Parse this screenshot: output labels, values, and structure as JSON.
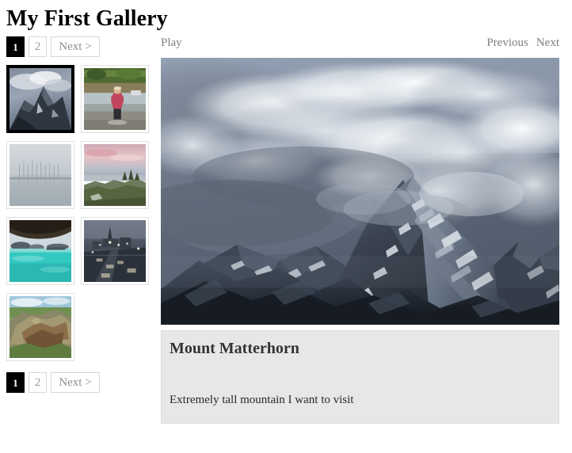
{
  "page": {
    "title": "My First Gallery"
  },
  "pagination": {
    "pages": [
      {
        "label": "1",
        "active": true
      },
      {
        "label": "2",
        "active": false
      }
    ],
    "next_label": "Next >"
  },
  "stage_controls": {
    "play_label": "Play",
    "previous_label": "Previous",
    "next_label": "Next"
  },
  "thumbnails": [
    {
      "name": "thumb-mount-matterhorn",
      "alt": "Mount Matterhorn peak with clouds",
      "selected": true
    },
    {
      "name": "thumb-person-at-river",
      "alt": "Person in red jacket standing by a river",
      "selected": false
    },
    {
      "name": "thumb-foggy-lake",
      "alt": "Foggy lake with bare trees",
      "selected": false
    },
    {
      "name": "thumb-coastal-sunset",
      "alt": "Coastal cliffs at pink sunset",
      "selected": false
    },
    {
      "name": "thumb-turquoise-bay",
      "alt": "Turquoise bay seen from a cave",
      "selected": false
    },
    {
      "name": "thumb-night-highway",
      "alt": "Rainy night city highway",
      "selected": false
    },
    {
      "name": "thumb-rocky-outcrop",
      "alt": "Rocky outcrop over green hills",
      "selected": false
    }
  ],
  "stage": {
    "alt": "Mount Matterhorn summit wreathed in clouds",
    "caption_title": "Mount Matterhorn",
    "caption_description": "Extremely tall mountain I want to visit"
  },
  "colors": {
    "active_page_bg": "#000000",
    "caption_bg": "#e7e7e7",
    "control_text": "#7e7e7e",
    "selected_thumb_border": "#000000"
  }
}
